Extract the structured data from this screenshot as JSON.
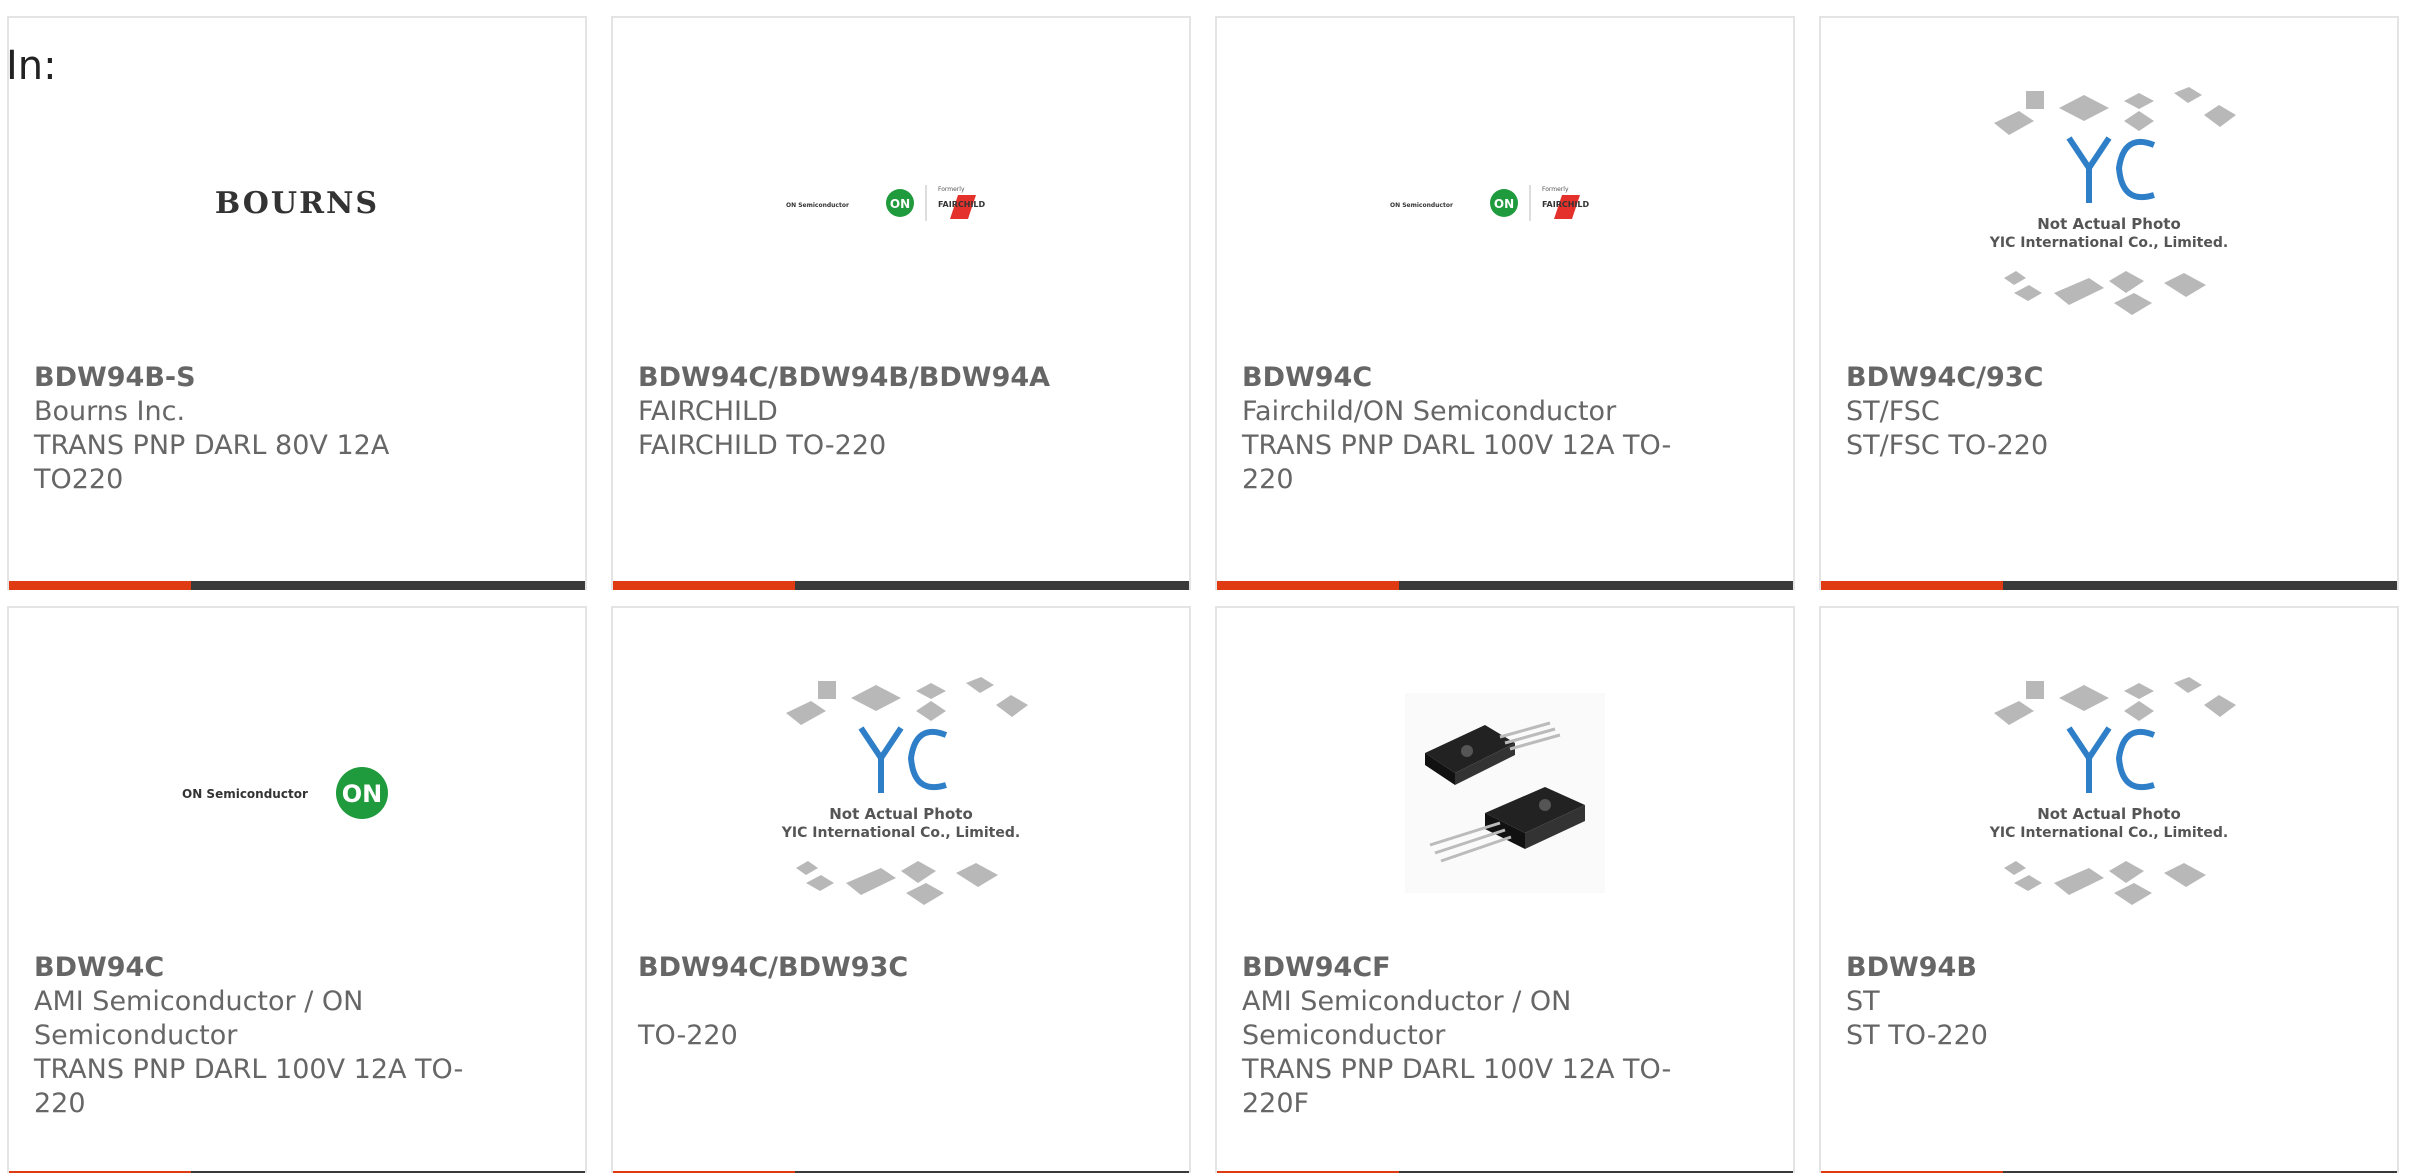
{
  "filter_label": "In:",
  "products": [
    {
      "part": "BDW94B-S",
      "manufacturer": "Bourns Inc.",
      "description": "TRANS PNP DARL 80V 12A TO220",
      "image": "bourns-logo",
      "logo_text": "BOURNS"
    },
    {
      "part": "BDW94C/BDW94B/BDW94A",
      "manufacturer": "FAIRCHILD",
      "description": "FAIRCHILD TO-220",
      "image": "on-fairchild-logo",
      "logo_text": "ON Semiconductor",
      "logo_text_2": "FAIRCHILD",
      "logo_sub": "Formerly"
    },
    {
      "part": "BDW94C",
      "manufacturer": "Fairchild/ON Semiconductor",
      "description": "TRANS PNP DARL 100V 12A TO-220",
      "image": "on-fairchild-logo",
      "logo_text": "ON Semiconductor",
      "logo_text_2": "FAIRCHILD",
      "logo_sub": "Formerly"
    },
    {
      "part": "BDW94C/93C",
      "manufacturer": "ST/FSC",
      "description": "ST/FSC TO-220",
      "image": "not-actual-photo",
      "logo_text": "Not Actual Photo",
      "logo_text_2": "YIC International Co., Limited."
    },
    {
      "part": "BDW94C",
      "manufacturer": "AMI Semiconductor / ON Semiconductor",
      "description": "TRANS PNP DARL 100V 12A TO-220",
      "image": "on-semi-logo",
      "logo_text": "ON Semiconductor"
    },
    {
      "part": "BDW94C/BDW93C",
      "manufacturer": "",
      "description": "TO-220",
      "image": "not-actual-photo",
      "logo_text": "Not Actual Photo",
      "logo_text_2": "YIC International Co., Limited."
    },
    {
      "part": "BDW94CF",
      "manufacturer": "AMI Semiconductor / ON Semiconductor",
      "description": "TRANS PNP DARL 100V 12A TO-220F",
      "image": "to220f-photo"
    },
    {
      "part": "BDW94B",
      "manufacturer": "ST",
      "description": "ST TO-220",
      "image": "not-actual-photo",
      "logo_text": "Not Actual Photo",
      "logo_text_2": "YIC International Co., Limited."
    }
  ],
  "colors": {
    "accent": "#e03a12",
    "bar": "#3a3a3a",
    "text": "#666666",
    "on_green": "#1f9a3c",
    "yic_blue": "#2f7fc8",
    "fairchild_red": "#e4312b"
  }
}
